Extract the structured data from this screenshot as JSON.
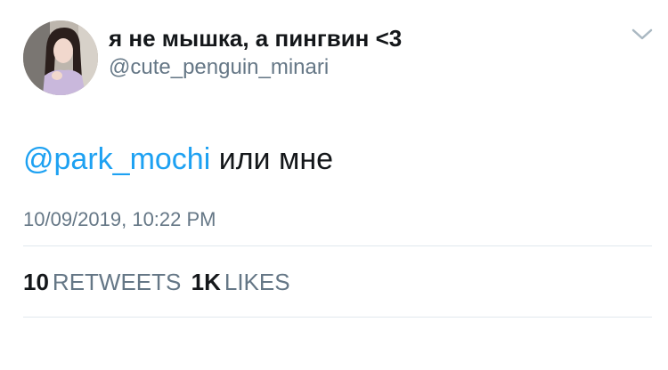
{
  "user": {
    "display_name": "я не мышка, а пингвин <3",
    "handle": "@cute_penguin_minari"
  },
  "tweet": {
    "mention": "@park_mochi",
    "text": " или мне",
    "timestamp": "10/09/2019, 10:22 PM"
  },
  "stats": {
    "retweets_count": "10",
    "retweets_label": "RETWEETS",
    "likes_count": "1K",
    "likes_label": "LIKES"
  },
  "colors": {
    "mention": "#1da1f2",
    "secondary_text": "#657786",
    "primary_text": "#14171a",
    "divider": "#e1e8ed"
  },
  "icons": {
    "menu": "chevron-down-icon"
  }
}
